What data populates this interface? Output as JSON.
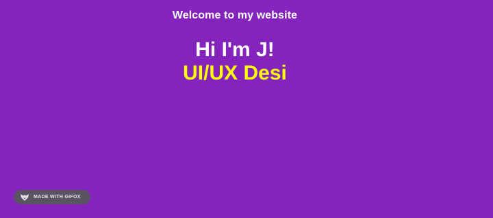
{
  "header": {
    "welcome_text": "Welcome to my website"
  },
  "hero": {
    "greeting": "Hi I'm J!",
    "role": "UI/UX Desi"
  },
  "badge": {
    "label": "MADE WITH GIFOX",
    "icon": "fox-icon"
  },
  "colors": {
    "background": "#8424bc",
    "text_primary": "#ffffff",
    "accent": "#ffff00",
    "badge_bg": "#5b5262"
  }
}
